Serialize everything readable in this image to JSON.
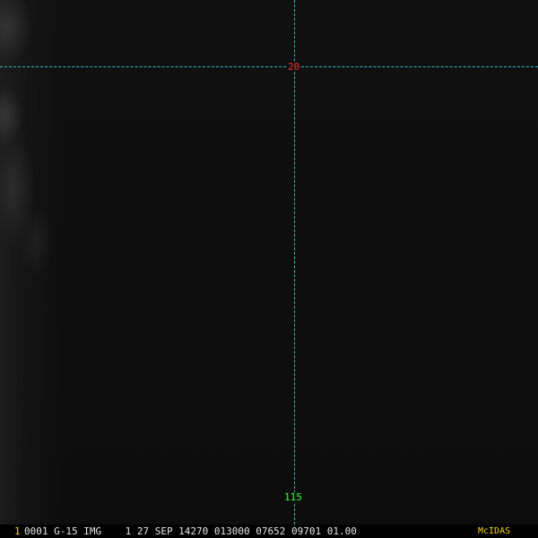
{
  "map": {
    "latitude_label": "20",
    "longitude_label": "115",
    "grid_color": "#2ac4c4",
    "latitude_label_color": "#ff3030",
    "longitude_label_color": "#33ff33"
  },
  "status_bar": {
    "frame_number": "1",
    "info_text": "0001 G-15 IMG    1 27 SEP 14270 013000 07652 09701 01.00",
    "product_label": "McIDAS",
    "accent_color": "#ffd400"
  }
}
